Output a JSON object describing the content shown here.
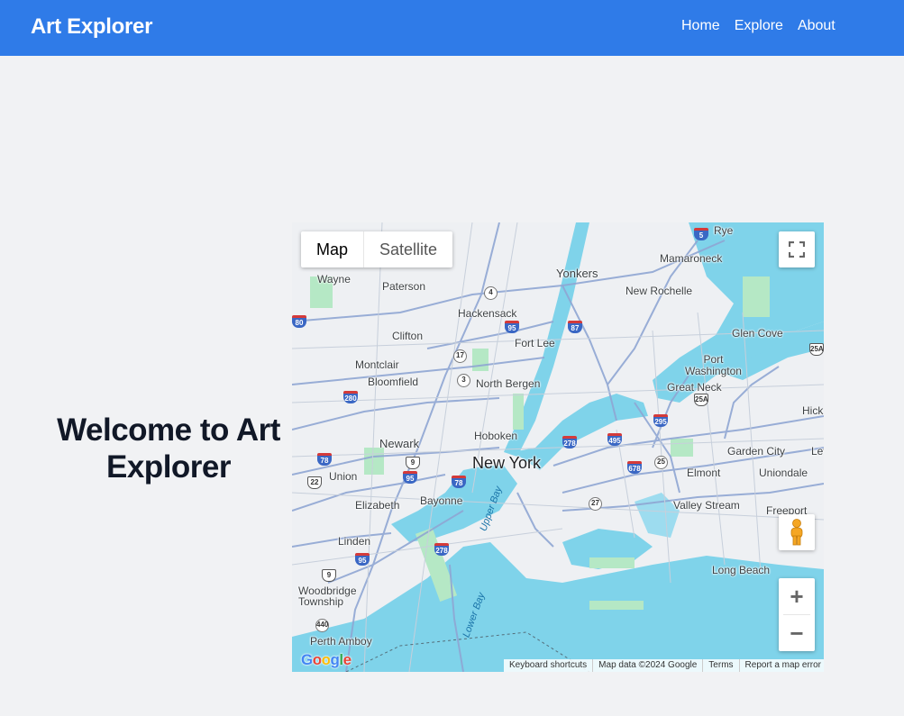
{
  "header": {
    "brand": "Art Explorer",
    "nav": [
      "Home",
      "Explore",
      "About"
    ]
  },
  "hero": {
    "title": "Welcome to Art Explorer"
  },
  "map": {
    "type_control": {
      "map_label": "Map",
      "satellite_label": "Satellite",
      "selected": "Map"
    },
    "labels": {
      "rye": "Rye",
      "yonkers": "Yonkers",
      "mamaroneck": "Mamaroneck",
      "wayne": "Wayne",
      "paterson": "Paterson",
      "new_rochelle": "New Rochelle",
      "hackensack": "Hackensack",
      "fort_lee": "Fort Lee",
      "clifton": "Clifton",
      "glen_cove": "Glen Cove",
      "montclair": "Montclair",
      "port_washington": "Port\nWashington",
      "bloomfield": "Bloomfield",
      "north_bergen": "North Bergen",
      "great_neck": "Great Neck",
      "hick": "Hick",
      "newark": "Newark",
      "hoboken": "Hoboken",
      "garden_city": "Garden City",
      "lev": "Lev",
      "new_york": "New York",
      "union": "Union",
      "elmont": "Elmont",
      "uniondale": "Uniondale",
      "bayonne": "Bayonne",
      "elizabeth": "Elizabeth",
      "valley_stream": "Valley Stream",
      "freeport": "Freeport",
      "upper_bay": "Upper Bay",
      "linden": "Linden",
      "long_beach": "Long Beach",
      "woodbridge": "Woodbridge\nTownship",
      "lower_bay": "Lower Bay",
      "perth_amboy": "Perth Amboy"
    },
    "shields": [
      "95",
      "87",
      "4",
      "80",
      "17",
      "3",
      "280",
      "295",
      "495",
      "278",
      "25A",
      "25",
      "678",
      "78",
      "9",
      "22",
      "27",
      "9",
      "440",
      "278",
      "95",
      "95",
      "78",
      "25A",
      "5"
    ],
    "attribution": [
      "Keyboard shortcuts",
      "Map data ©2024 Google",
      "Terms",
      "Report a map error"
    ],
    "logo": "Google",
    "zoom_in": "+",
    "zoom_out": "−"
  },
  "colors": {
    "nav_bg": "#2f7be8",
    "water": "#7fd3ea",
    "park": "#b5e8c5",
    "road": "#8fa6d3"
  }
}
